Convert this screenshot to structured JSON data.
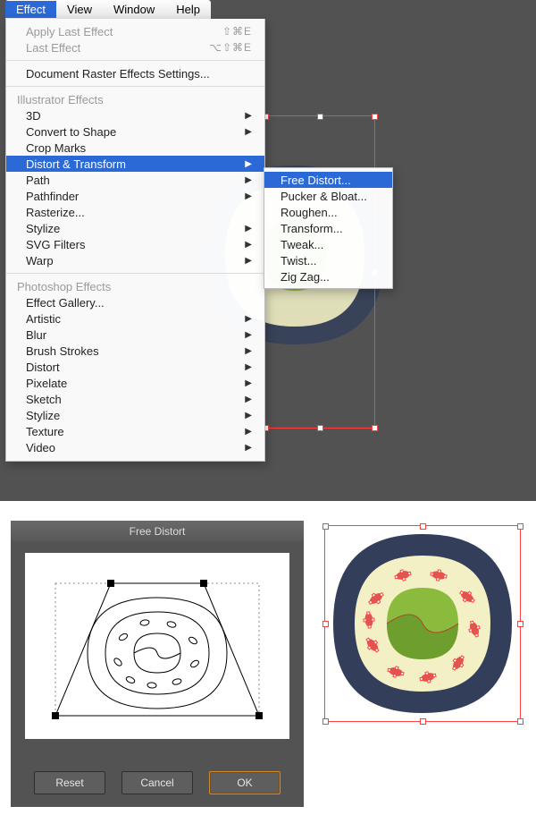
{
  "menubar": {
    "items": [
      "Effect",
      "View",
      "Window",
      "Help"
    ],
    "active": 0
  },
  "menu": {
    "apply_last": "Apply Last Effect",
    "apply_last_key": "⇧⌘E",
    "last": "Last Effect",
    "last_key": "⌥⇧⌘E",
    "doc_raster": "Document Raster Effects Settings...",
    "sec_ai": "Illustrator Effects",
    "ai_items": [
      "3D",
      "Convert to Shape",
      "Crop Marks",
      "Distort & Transform",
      "Path",
      "Pathfinder",
      "Rasterize...",
      "Stylize",
      "SVG Filters",
      "Warp"
    ],
    "ai_has_sub": [
      true,
      true,
      false,
      true,
      true,
      true,
      false,
      true,
      true,
      true
    ],
    "ai_highlight_index": 3,
    "sec_ps": "Photoshop Effects",
    "ps_items": [
      "Effect Gallery...",
      "Artistic",
      "Blur",
      "Brush Strokes",
      "Distort",
      "Pixelate",
      "Sketch",
      "Stylize",
      "Texture",
      "Video"
    ],
    "ps_has_sub": [
      false,
      true,
      true,
      true,
      true,
      true,
      true,
      true,
      true,
      true
    ]
  },
  "submenu": {
    "items": [
      "Free Distort...",
      "Pucker & Bloat...",
      "Roughen...",
      "Transform...",
      "Tweak...",
      "Twist...",
      "Zig Zag..."
    ],
    "highlight_index": 0
  },
  "dialog": {
    "title": "Free Distort",
    "reset": "Reset",
    "cancel": "Cancel",
    "ok": "OK"
  },
  "colors": {
    "nori": "#323e5a",
    "rice": "#f2f0c4",
    "leaf1": "#8bbb3d",
    "leaf2": "#6e9e2e",
    "seed": "#e0564f"
  }
}
